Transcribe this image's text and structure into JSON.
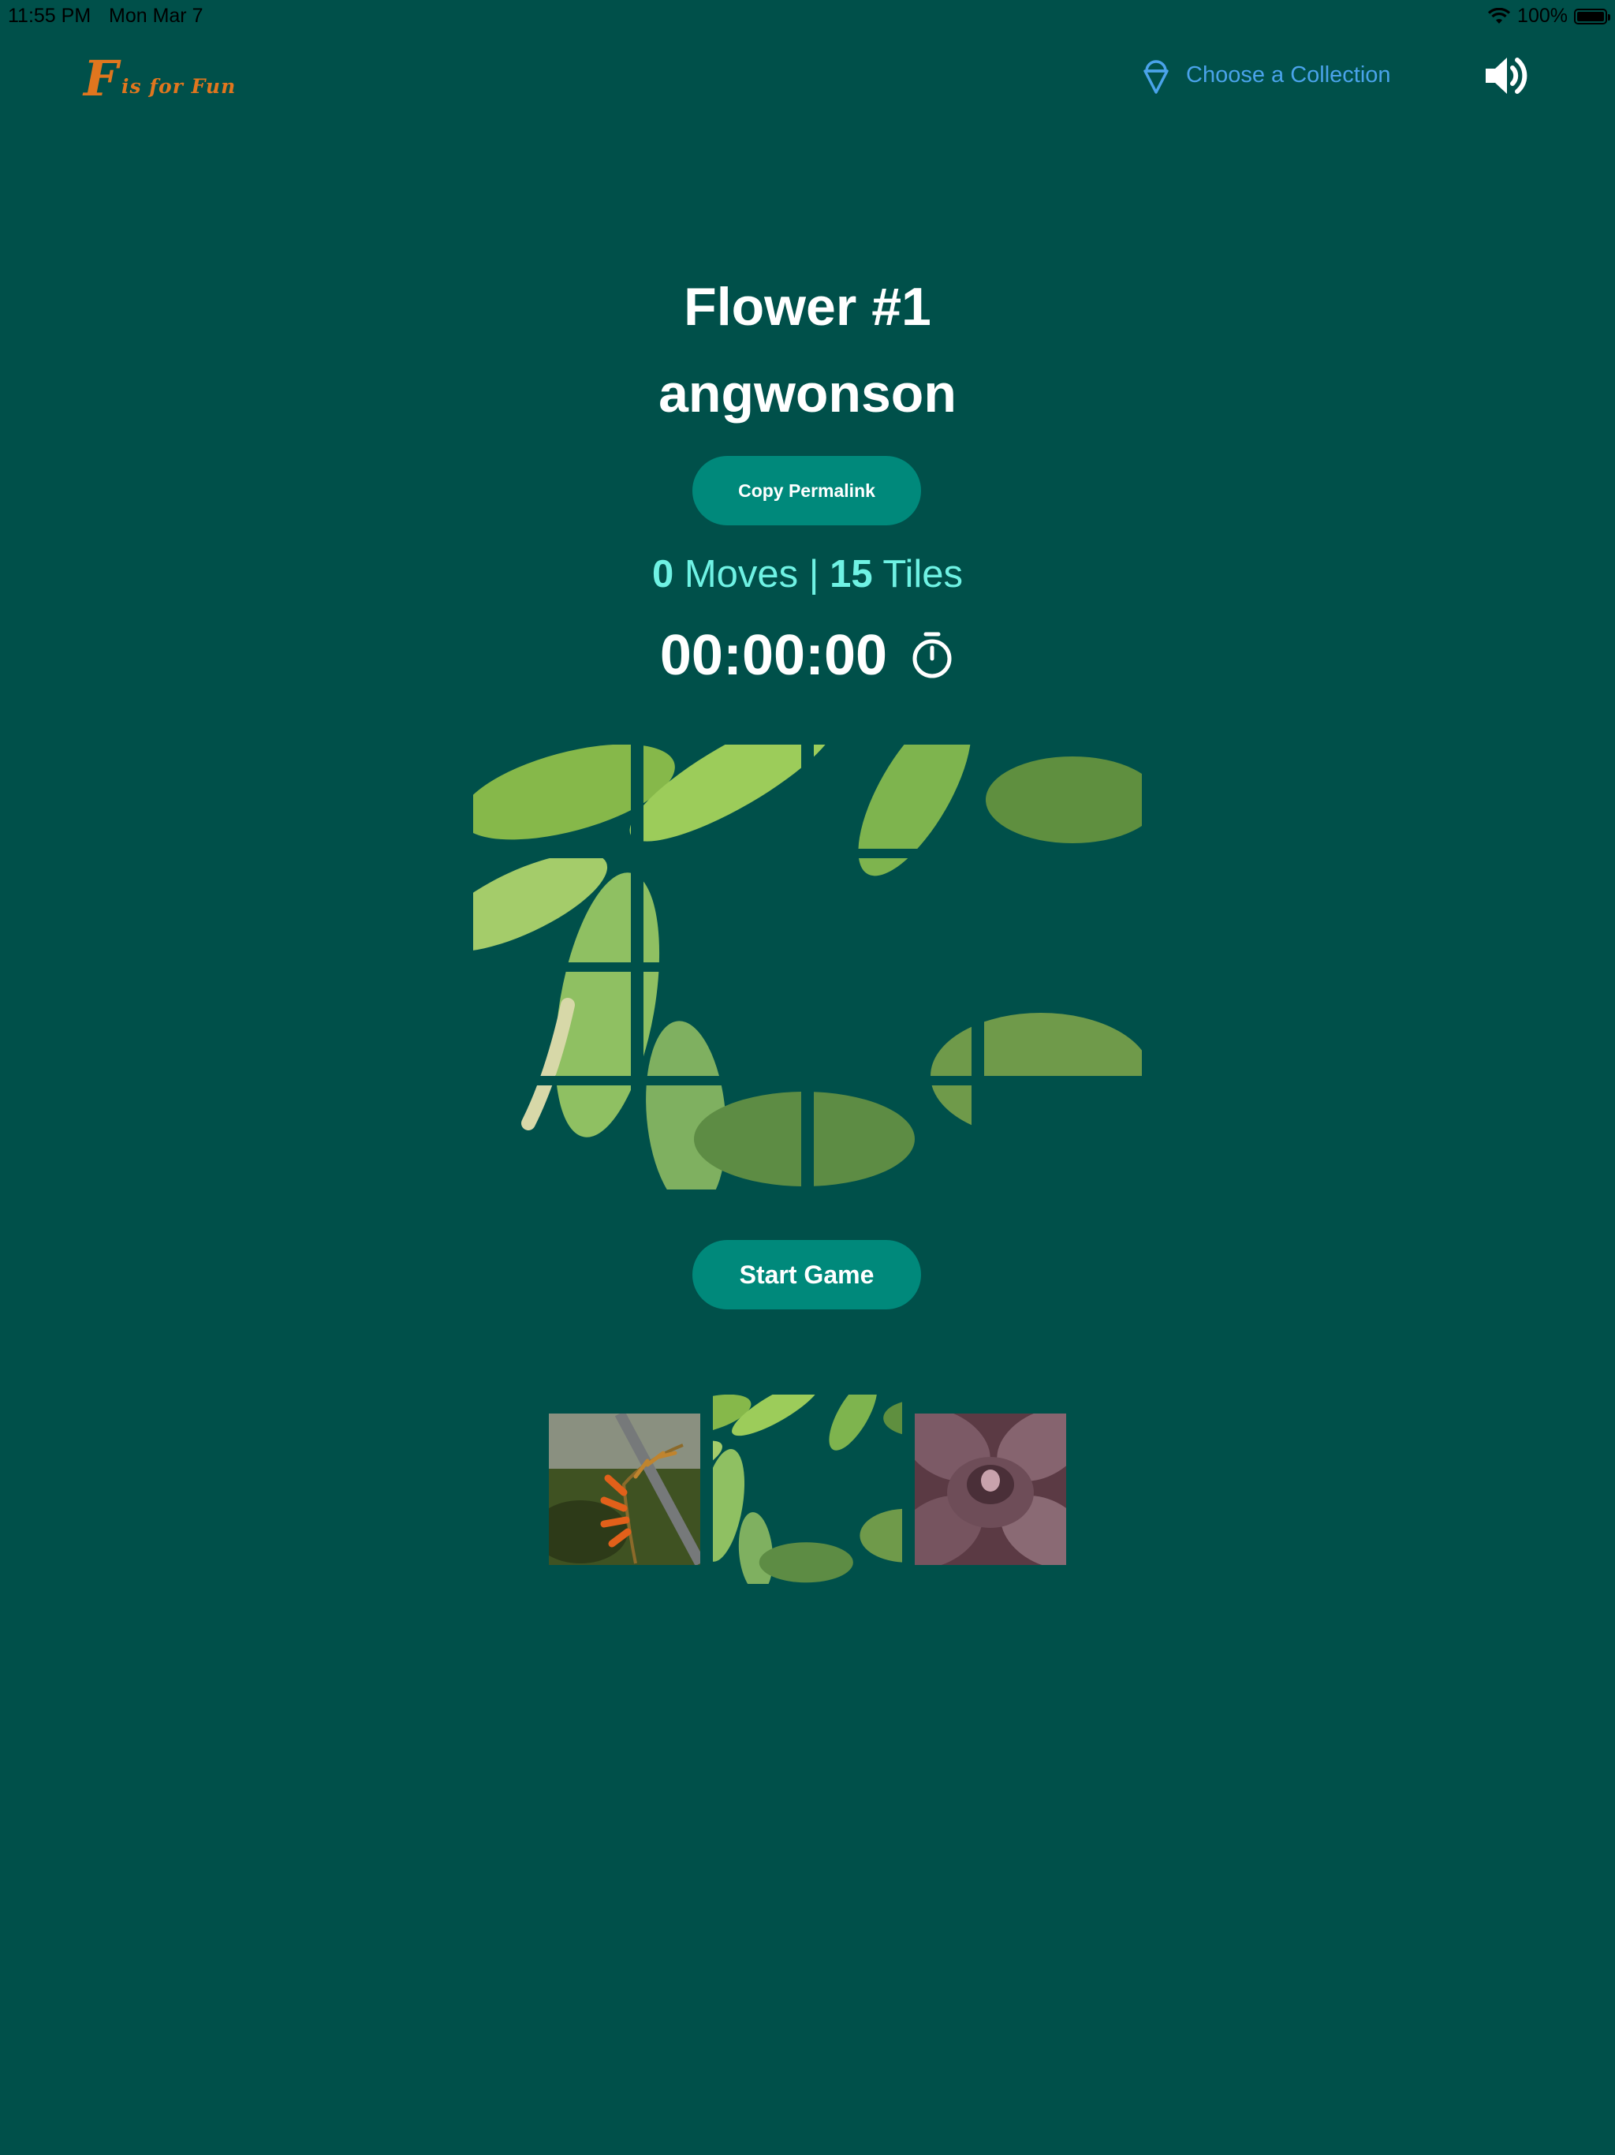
{
  "status_bar": {
    "time": "11:55 PM",
    "date": "Mon Mar 7",
    "battery": "100%"
  },
  "header": {
    "logo_initial": "F",
    "logo_text": "is for Fun",
    "collection_label": "Choose a Collection",
    "collection_icon": "ice-cream-icon",
    "sound_icon": "speaker-volume-icon"
  },
  "puzzle": {
    "title": "Flower #1",
    "author": "angwonson",
    "copy_label": "Copy Permalink",
    "moves": "0",
    "moves_label": "Moves",
    "separator": "|",
    "tiles": "15",
    "tiles_label": "Tiles",
    "timer": "00:00:00",
    "timer_icon": "stopwatch-icon",
    "grid": {
      "rows": 4,
      "cols": 4,
      "empty_slot": 16
    },
    "start_label": "Start Game"
  },
  "thumbnails": [
    {
      "name": "orange-flower",
      "selected": false
    },
    {
      "name": "pink-flower",
      "selected": true
    },
    {
      "name": "succulent",
      "selected": false
    }
  ],
  "colors": {
    "background": "#00504a",
    "button": "#00897b",
    "counter": "#6ff2e4",
    "logo": "#e0761e",
    "link": "#4aa3ea"
  }
}
